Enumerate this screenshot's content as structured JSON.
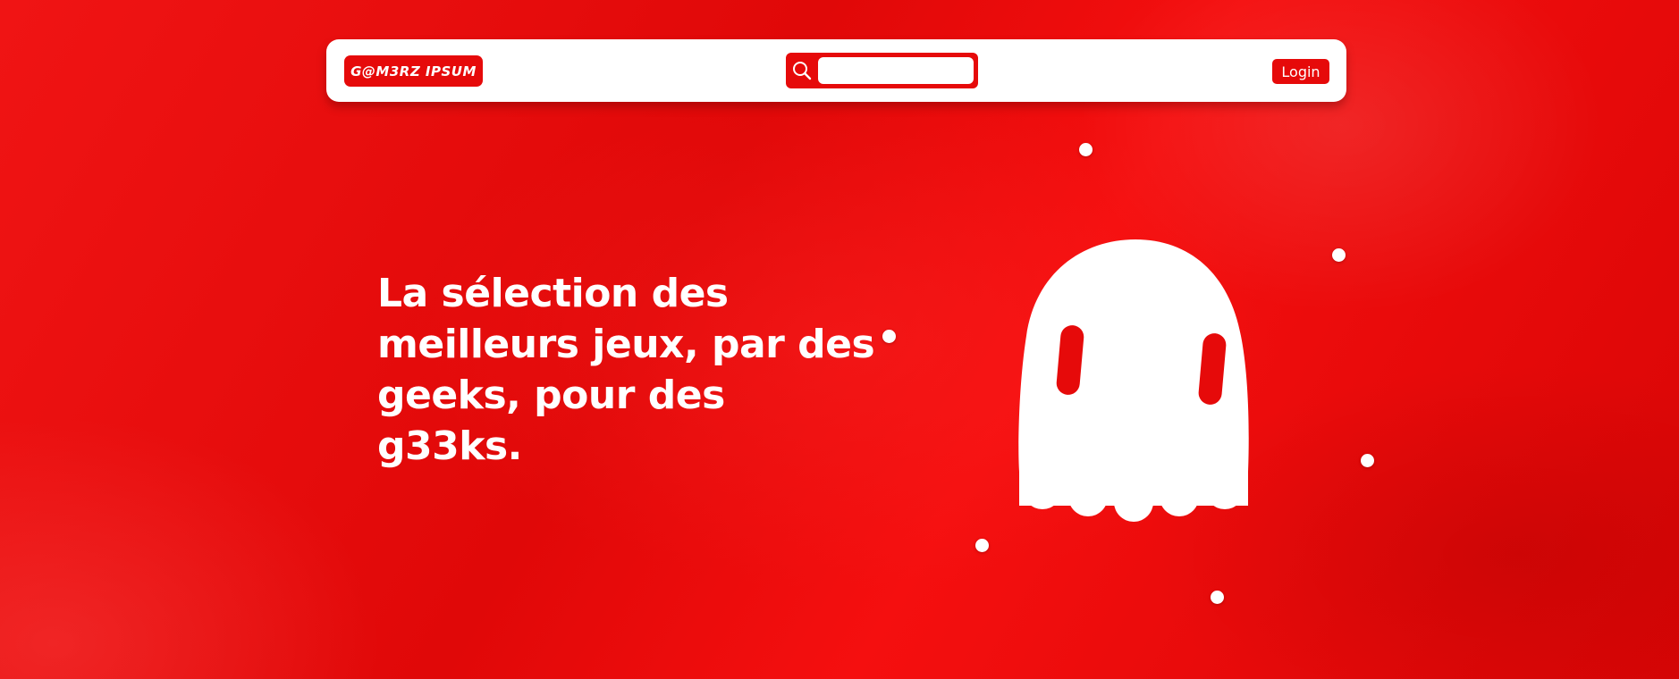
{
  "navbar": {
    "logo_text": "G@M3RZ IPSUM",
    "search": {
      "value": "",
      "placeholder": ""
    },
    "login_label": "Login"
  },
  "hero": {
    "headline": "La sélection des\nmeilleurs jeux, par des\ngeeks, pour des g33ks."
  },
  "icons": {
    "search": "search-icon",
    "mascot": "ghost-icon",
    "decor": "dot"
  },
  "colors": {
    "brand_red": "#e60a0a",
    "white": "#ffffff"
  }
}
